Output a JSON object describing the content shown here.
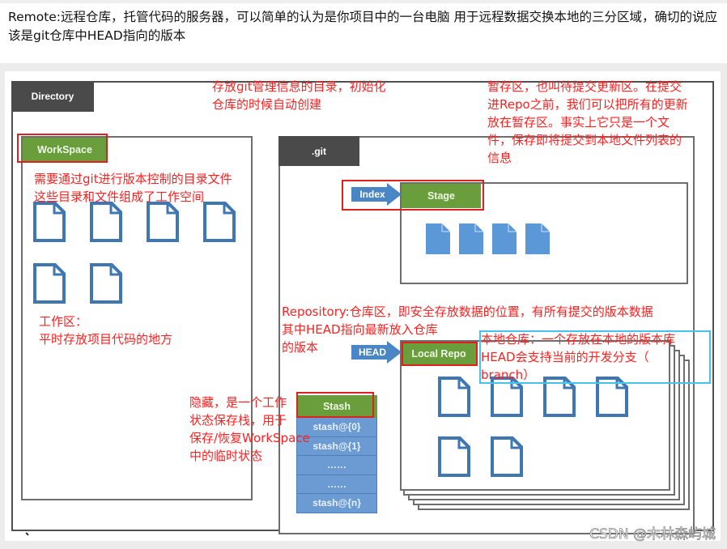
{
  "caption": {
    "text": "Remote:远程仓库，托管代码的服务器，可以简单的认为是你项目中的一台电脑 用于远程数据交换本地的三分区域，确切的说应该是git仓库中HEAD指向的版本"
  },
  "diagram": {
    "directory_label": "Directory",
    "workspace_label": "WorkSpace",
    "git_label": ".git",
    "index_label": "Index",
    "stage_label": "Stage",
    "head_label": "HEAD",
    "local_repo_label": "Local Repo",
    "stash_label": "Stash",
    "stash_entries": [
      "stash@{0}",
      "stash@{1}",
      "……",
      "……",
      "stash@{n}"
    ],
    "workspace_file_count": 6,
    "stage_file_count": 4,
    "local_repo_file_count": 6
  },
  "annotations": {
    "git_dir": [
      "存放git管理信息的目录，初始化",
      "仓库的时候自动创建"
    ],
    "stage": [
      "暂存区，也叫待提交更新区。在提交",
      "进Repo之前，我们可以把所有的更新",
      "放在暂存区。事实上它只是一个文",
      "件，保存即将提交到本地文件列表的",
      "信息"
    ],
    "workspace": [
      "需要通过git进行版本控制的目录文件",
      "这些目录和文件组成了工作空间"
    ],
    "workspace_area": [
      "工作区：",
      "平时存放项目代码的地方"
    ],
    "repository": [
      "Repository:仓库区，即安全存放数据的位置，有所有提交的版本数据",
      "其中HEAD指向最新放入仓库",
      "的版本"
    ],
    "local_repo": [
      "本地仓库：一个存放在本地的版本库",
      "HEAD会支持当前的开发分支（",
      "branch）"
    ],
    "stash": [
      "隐藏，是一个工作",
      "状态保存栈，用于",
      "保存/恢复WorkSpace",
      "中的临时状态"
    ]
  },
  "colors": {
    "annotation_red": "#ff2020",
    "tab_dark": "#4a4a4a",
    "tab_green": "#6a9e3c",
    "arrow_blue": "#4a86c5",
    "file_outline_blue": "#3f77b3",
    "file_fill_blue": "#5a98d8",
    "stash_blue": "#6b9bd2",
    "highlight_cyan": "#45c3ea"
  },
  "watermark": "CSDN @木林森屿城"
}
